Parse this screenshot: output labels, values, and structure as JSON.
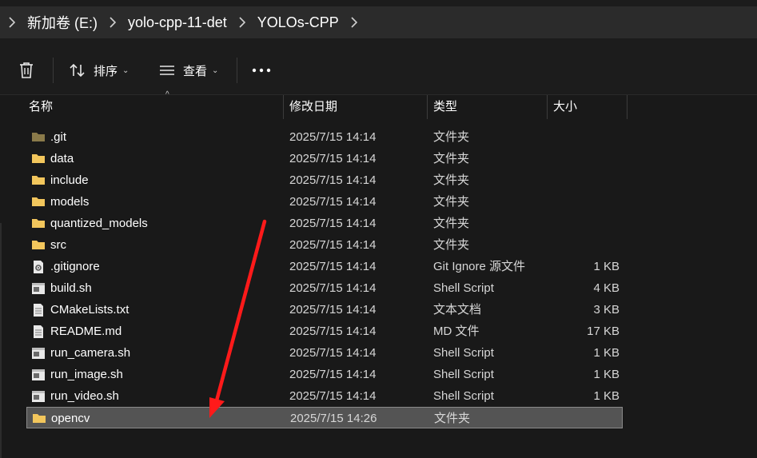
{
  "breadcrumb": {
    "items": [
      "新加卷 (E:)",
      "yolo-cpp-11-det",
      "YOLOs-CPP"
    ]
  },
  "toolbar": {
    "sort_label": "排序",
    "view_label": "查看",
    "delete_icon": "trash-icon",
    "more_icon": "more-horizontal-icon"
  },
  "columns": {
    "name": "名称",
    "modified": "修改日期",
    "type": "类型",
    "size": "大小"
  },
  "files": [
    {
      "name": ".git",
      "modified": "2025/7/15 14:14",
      "type": "文件夹",
      "size": "",
      "icon": "folder-dim-icon"
    },
    {
      "name": "data",
      "modified": "2025/7/15 14:14",
      "type": "文件夹",
      "size": "",
      "icon": "folder-icon"
    },
    {
      "name": "include",
      "modified": "2025/7/15 14:14",
      "type": "文件夹",
      "size": "",
      "icon": "folder-icon"
    },
    {
      "name": "models",
      "modified": "2025/7/15 14:14",
      "type": "文件夹",
      "size": "",
      "icon": "folder-icon"
    },
    {
      "name": "quantized_models",
      "modified": "2025/7/15 14:14",
      "type": "文件夹",
      "size": "",
      "icon": "folder-icon"
    },
    {
      "name": "src",
      "modified": "2025/7/15 14:14",
      "type": "文件夹",
      "size": "",
      "icon": "folder-icon"
    },
    {
      "name": ".gitignore",
      "modified": "2025/7/15 14:14",
      "type": "Git Ignore 源文件",
      "size": "1 KB",
      "icon": "settings-file-icon"
    },
    {
      "name": "build.sh",
      "modified": "2025/7/15 14:14",
      "type": "Shell Script",
      "size": "4 KB",
      "icon": "script-file-icon"
    },
    {
      "name": "CMakeLists.txt",
      "modified": "2025/7/15 14:14",
      "type": "文本文档",
      "size": "3 KB",
      "icon": "text-file-icon"
    },
    {
      "name": "README.md",
      "modified": "2025/7/15 14:14",
      "type": "MD 文件",
      "size": "17 KB",
      "icon": "text-file-icon"
    },
    {
      "name": "run_camera.sh",
      "modified": "2025/7/15 14:14",
      "type": "Shell Script",
      "size": "1 KB",
      "icon": "script-file-icon"
    },
    {
      "name": "run_image.sh",
      "modified": "2025/7/15 14:14",
      "type": "Shell Script",
      "size": "1 KB",
      "icon": "script-file-icon"
    },
    {
      "name": "run_video.sh",
      "modified": "2025/7/15 14:14",
      "type": "Shell Script",
      "size": "1 KB",
      "icon": "script-file-icon"
    },
    {
      "name": "opencv",
      "modified": "2025/7/15 14:26",
      "type": "文件夹",
      "size": "",
      "icon": "folder-icon",
      "selected": true
    }
  ],
  "colors": {
    "folder": "#f2c55c",
    "folder_dim": "#8a7a4a",
    "annotation_arrow": "#ff0000",
    "selection": "#545454"
  }
}
